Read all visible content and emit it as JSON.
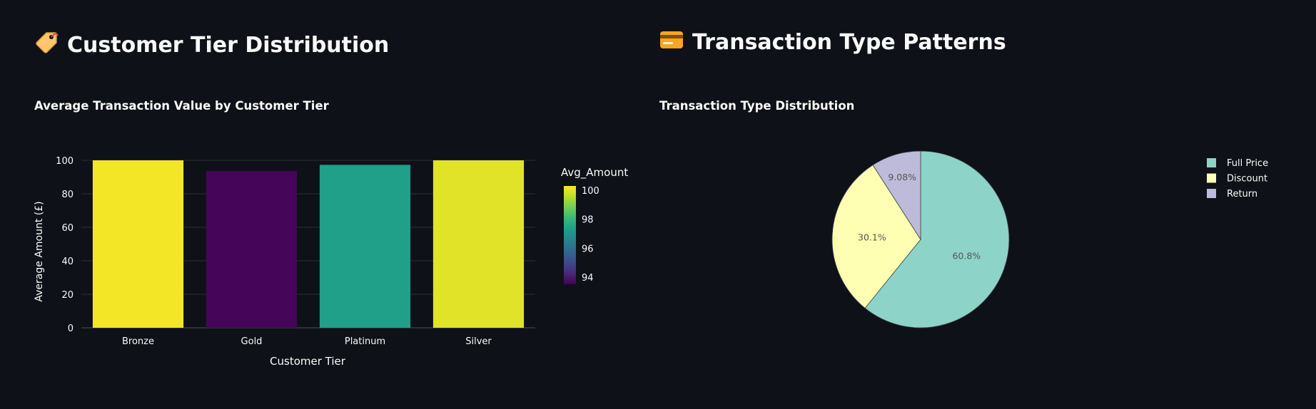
{
  "left": {
    "heading": "Customer Tier Distribution",
    "heading_icon": "label-tag-icon",
    "chart_title": "Average Transaction Value by Customer Tier"
  },
  "right": {
    "heading": "Transaction Type Patterns",
    "heading_icon": "credit-card-icon",
    "chart_title": "Transaction Type Distribution"
  },
  "chart_data": [
    {
      "type": "bar",
      "title": "Average Transaction Value by Customer Tier",
      "categories": [
        "Bronze",
        "Gold",
        "Platinum",
        "Silver"
      ],
      "values": [
        100.2,
        93.6,
        97.3,
        100.0
      ],
      "xlabel": "Customer Tier",
      "ylabel": "Average Amount (£)",
      "ylim": [
        0,
        100
      ],
      "yticks": [
        0,
        20,
        40,
        60,
        80,
        100
      ],
      "grid": true,
      "colorbar": {
        "title": "Avg_Amount",
        "ticks": [
          94,
          96,
          98,
          100
        ],
        "range": [
          93.5,
          100.3
        ],
        "colorscale": "viridis"
      }
    },
    {
      "type": "pie",
      "title": "Transaction Type Distribution",
      "labels": [
        "Full Price",
        "Discount",
        "Return"
      ],
      "values": [
        60.8,
        30.1,
        9.08
      ],
      "percent_labels": [
        "60.8%",
        "30.1%",
        "9.08%"
      ],
      "colors": [
        "#8dd3c7",
        "#ffffb3",
        "#bebada"
      ],
      "legend": "top-right"
    }
  ]
}
